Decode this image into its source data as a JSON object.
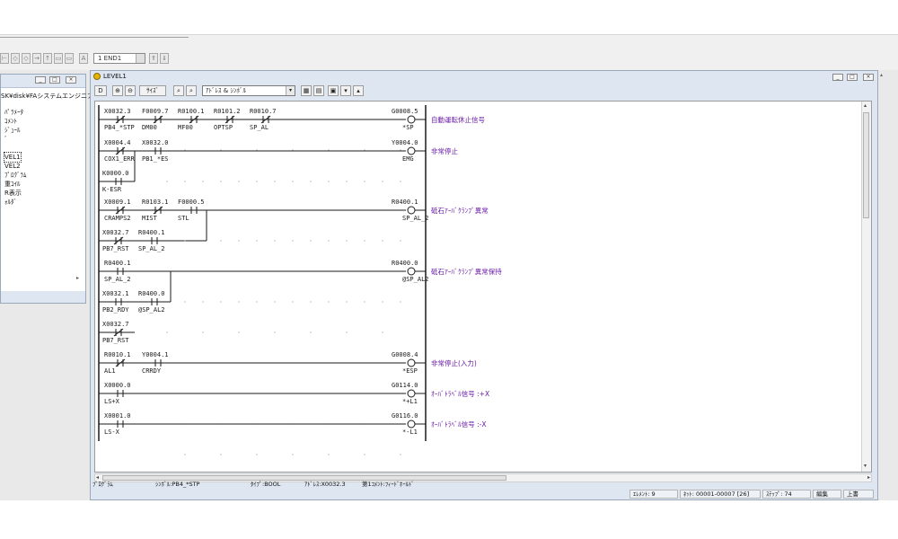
{
  "top_toolbar": {
    "end_combo": "1  END1"
  },
  "left_panel": {
    "tree": [
      "SK¥disk¥FAシステムエンジニアリ",
      "ﾊﾟﾗﾒｰﾀ",
      "ｺﾒﾝﾄ",
      "ｼﾞｭｰﾙ",
      "ﾞ",
      "VEL1",
      "VEL2",
      "ﾌﾟﾛｸﾞﾗﾑ",
      "重ｺｲﾙ",
      "R表示",
      "ｫﾙﾀﾞ"
    ]
  },
  "main_window": {
    "title": "LEVEL1",
    "toolbar": {
      "size_button": "ｻｲｽﾞ",
      "display_combo": "ｱﾄﾞﾚｽ & ｼﾝﾎﾞﾙ"
    }
  },
  "ladder": {
    "rungs": [
      {
        "contacts": [
          {
            "addr": "X0032.3",
            "sym": "PB4_*STP",
            "nc": true
          },
          {
            "addr": "F0009.7",
            "sym": "DM00",
            "nc": true
          },
          {
            "addr": "R0100.1",
            "sym": "MF00",
            "nc": true
          },
          {
            "addr": "R0101.2",
            "sym": "OPTSP",
            "nc": true
          },
          {
            "addr": "R0010.7",
            "sym": "SP_AL",
            "nc": true
          }
        ],
        "coil": {
          "addr": "G0008.5",
          "sym": "*SP"
        },
        "comment": "自動運転休止信号"
      },
      {
        "contacts": [
          {
            "addr": "X0004.4",
            "sym": "COX1_ERR",
            "nc": true
          },
          {
            "addr": "X0032.0",
            "sym": "PB1_*ES",
            "nc": false
          }
        ],
        "branches": [
          {
            "addr": "K0000.0",
            "sym": "K-ESR",
            "nc": false
          }
        ],
        "coil": {
          "addr": "Y0004.0",
          "sym": "EMG"
        },
        "comment": "非常停止"
      },
      {
        "contacts": [
          {
            "addr": "X0009.1",
            "sym": "CRAMPS2",
            "nc": true
          },
          {
            "addr": "R0103.1",
            "sym": "MIST",
            "nc": true
          },
          {
            "addr": "F0000.5",
            "sym": "STL",
            "nc": false
          }
        ],
        "branches": [
          {
            "addr": "X0032.7",
            "sym": "PB7_RST",
            "nc": true
          },
          {
            "addr": "R0400.1",
            "sym": "SP_AL_2",
            "nc": false
          }
        ],
        "coil": {
          "addr": "R0400.1",
          "sym": "SP_AL_2"
        },
        "comment": "砥石ｱｰﾊﾞｸﾗﾝﾌﾟ異常"
      },
      {
        "contacts": [
          {
            "addr": "R0400.1",
            "sym": "SP_AL_2",
            "nc": false
          }
        ],
        "branches": [
          {
            "addr": "X0032.1",
            "sym": "PB2_RDY",
            "nc": false
          },
          {
            "addr": "R0400.0",
            "sym": "@SP_AL2",
            "nc": false
          },
          {
            "addr": "X0032.7",
            "sym": "PB7_RST",
            "nc": true
          }
        ],
        "coil": {
          "addr": "R0400.0",
          "sym": "@SP_AL2"
        },
        "comment": "砥石ｱｰﾊﾞｸﾗﾝﾌﾟ異常保持"
      },
      {
        "contacts": [
          {
            "addr": "R0010.1",
            "sym": "AL1",
            "nc": true
          },
          {
            "addr": "Y0004.1",
            "sym": "CRRDY",
            "nc": false
          }
        ],
        "coil": {
          "addr": "G0008.4",
          "sym": "*ESP"
        },
        "comment": "非常停止(入力)"
      },
      {
        "contacts": [
          {
            "addr": "X0000.0",
            "sym": "LS+X",
            "nc": false
          }
        ],
        "coil": {
          "addr": "G0114.0",
          "sym": "*+L1"
        },
        "comment": "ｵｰﾊﾞﾄﾗﾍﾞﾙ信号 :+X"
      },
      {
        "contacts": [
          {
            "addr": "X0001.0",
            "sym": "LS-X",
            "nc": false
          }
        ],
        "coil": {
          "addr": "G0116.0",
          "sym": "*-L1"
        },
        "comment": "ｵｰﾊﾞﾄﾗﾍﾞﾙ信号 :-X"
      }
    ]
  },
  "status": {
    "program": "ﾌﾟﾛｸﾞﾗﾑ",
    "symbol": "ｼﾝﾎﾞﾙ:PB4_*STP",
    "type": "ﾀｲﾌﾟ:BOOL",
    "address": "ｱﾄﾞﾚｽ:X0032.3",
    "comment": "第1ｺﾒﾝﾄ:ﾌｨｰﾄﾞﾎｰﾙﾄﾞ",
    "element": "ｴﾚﾒﾝﾄ: 9",
    "net": "ﾈｯﾄ: 00001-00007 [26]",
    "step": "ｽﾃｯﾌﾟ: 74",
    "mode": "編集",
    "overwrite": "上書"
  },
  "colors": {
    "comment_text": "#6a1aa8",
    "ladder_line": "#1a1a1a"
  }
}
